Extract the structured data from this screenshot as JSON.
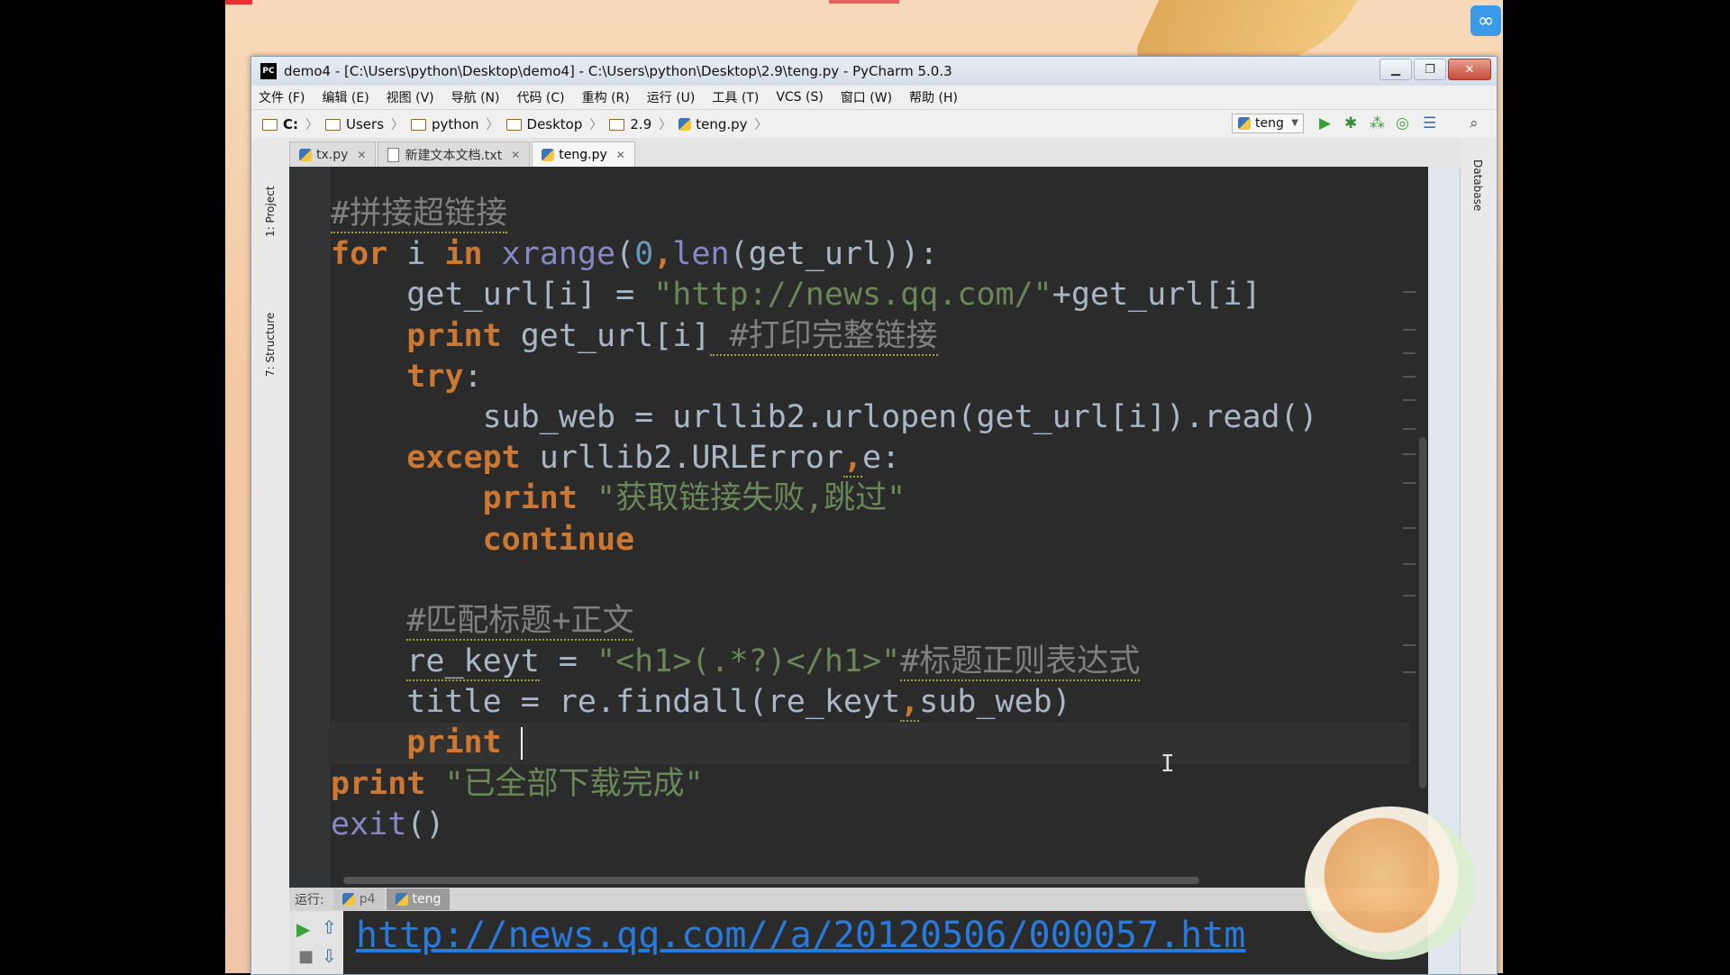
{
  "window": {
    "title": "demo4 - [C:\\Users\\python\\Desktop\\demo4] - C:\\Users\\python\\Desktop\\2.9\\teng.py - PyCharm 5.0.3",
    "app_icon": "PC"
  },
  "menu": [
    "文件 (F)",
    "编辑 (E)",
    "视图 (V)",
    "导航 (N)",
    "代码 (C)",
    "重构 (R)",
    "运行 (U)",
    "工具 (T)",
    "VCS (S)",
    "窗口 (W)",
    "帮助 (H)"
  ],
  "breadcrumb": [
    "C:",
    "Users",
    "python",
    "Desktop",
    "2.9",
    "teng.py"
  ],
  "run_config": "teng",
  "tabs": [
    "tx.py",
    "新建文本文档.txt",
    "teng.py"
  ],
  "left_panels": [
    "1: Project",
    "7: Structure"
  ],
  "right_panels": [
    "Database"
  ],
  "code": {
    "l1_comment": "#拼接超链接",
    "l2_for": "for",
    "l2_i": " i ",
    "l2_in": "in",
    "l2_sp": " ",
    "l2_xrange": "xrange",
    "l2_p": "(",
    "l2_zero": "0",
    "l2_comma": ",",
    "l2_len": "len",
    "l2_rest": "(get_url)):",
    "l3_a": "    get_url[i] = ",
    "l3_str": "\"http://news.qq.com/\"",
    "l3_b": "+get_url[i]",
    "l4_indent": "    ",
    "l4_print": "print",
    "l4_a": " get_url[i]",
    "l4_cm": " #打印完整链接",
    "l5_indent": "    ",
    "l5_try": "try",
    "l5_colon": ":",
    "l6": "        sub_web = urllib2.urlopen(get_url[i]).read()",
    "l7_indent": "    ",
    "l7_except": "except",
    "l7_a": " urllib2.URLError",
    "l7_comma": ",",
    "l7_b": "e:",
    "l8_indent": "        ",
    "l8_print": "print",
    "l8_sp": " ",
    "l8_str": "\"获取链接失败,跳过\"",
    "l9_indent": "        ",
    "l9_continue": "continue",
    "l11_indent": "    ",
    "l11_cm": "#匹配标题+正文",
    "l12_a": "    ",
    "l12_var": "re_keyt",
    "l12_eq": " = ",
    "l12_str": "\"<h1>(.*?)</h1>\"",
    "l12_cm": "#标题正则表达式",
    "l13_a": "    title = re.findall(re_keyt",
    "l13_comma": ",",
    "l13_b": "sub_web)",
    "l14_indent": "    ",
    "l14_print": "print",
    "l14_sp": " ",
    "l15_print": "print",
    "l15_sp": " ",
    "l15_str": "\"已全部下载完成\"",
    "l16_exit": "exit",
    "l16_paren": "()"
  },
  "run_panel": {
    "label": "运行:",
    "tabs": [
      "p4",
      "teng"
    ],
    "output": "http://news.qq.com//a/20120506/000057.htm"
  },
  "colors": {
    "keyword": "#cc7832",
    "string": "#6a8759",
    "comment": "#808080",
    "builtin": "#8888c6",
    "number": "#6897bb",
    "editor_bg": "#2b2b2b"
  }
}
